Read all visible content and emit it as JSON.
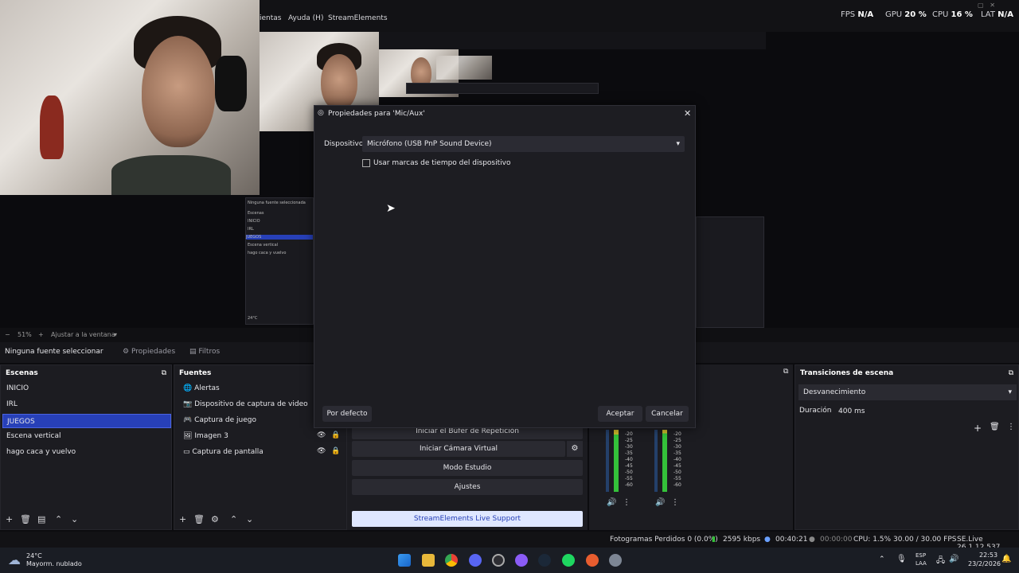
{
  "menubar": {
    "items": [
      "ientas",
      "Ayuda (H)",
      "StreamElements"
    ]
  },
  "stats": {
    "fps_label": "FPS",
    "fps_value": "N/A",
    "gpu_label": "GPU",
    "gpu_value": "20 %",
    "cpu_label": "CPU",
    "cpu_value": "16 %",
    "lat_label": "LAT",
    "lat_value": "N/A"
  },
  "preview": {
    "mini_scenes": [
      "Escenas",
      "INICIO",
      "IRL",
      "JUEGOS",
      "Escena vertical",
      "hago caca y vuelvo"
    ],
    "mini_source_none": "Ninguna fuente seleccionada",
    "mini_weather": "24°C"
  },
  "zoom": {
    "value": "51%",
    "fit_label": "Ajustar a la ventana"
  },
  "toolbar": {
    "no_source": "Ninguna fuente seleccionar",
    "properties_label": "Propiedades",
    "filters_label": "Filtros"
  },
  "scenes": {
    "title": "Escenas",
    "items": [
      "INICIO",
      "IRL",
      "JUEGOS",
      "Escena vertical",
      "hago caca y vuelvo"
    ],
    "selected_index": 2
  },
  "sources": {
    "title": "Fuentes",
    "items": [
      "Alertas",
      "Dispositivo de captura de video",
      "Captura de juego",
      "Imagen 3",
      "Captura de pantalla"
    ]
  },
  "controls": {
    "replay_label": "Iniciar el Búfer de Repetición",
    "virtualcam_label": "Iniciar Cámara Virtual",
    "studio_label": "Modo Estudio",
    "settings_label": "Ajustes",
    "support_label": "StreamElements Live Support"
  },
  "mixer": {
    "scale": [
      "-20",
      "-25",
      "-30",
      "-35",
      "-40",
      "-45",
      "-50",
      "-55",
      "-60"
    ]
  },
  "transitions": {
    "title": "Transiciones de escena",
    "selected": "Desvanecimiento",
    "duration_label": "Duración",
    "duration_value": "400 ms"
  },
  "dialog": {
    "title": "Propiedades para 'Mic/Aux'",
    "device_label": "Dispositivo",
    "device_value": "Micrófono (USB PnP Sound Device)",
    "checkbox_label": "Usar marcas de tiempo del dispositivo",
    "defaults_label": "Por defecto",
    "accept_label": "Aceptar",
    "cancel_label": "Cancelar"
  },
  "statusbar": {
    "dropped": "Fotogramas Perdidos 0 (0.0%)",
    "bitrate": "2595 kbps",
    "live_time": "00:40:21",
    "rec_time": "00:00:00",
    "cpu": "CPU: 1.5%",
    "fps": "30.00 / 30.00 FPS",
    "version": "SE.Live 26.1.12.537"
  },
  "taskbar": {
    "weather_temp": "24°C",
    "weather_desc": "Mayorm. nublado",
    "lang_top": "ESP",
    "lang_bottom": "LAA",
    "time": "22:53",
    "date": "23/2/2026"
  },
  "colors": {
    "accent": "#2740b8",
    "support_bg": "#dfe7ff",
    "meter_green": "#34c23a",
    "meter_yellow": "#c9b82a"
  }
}
